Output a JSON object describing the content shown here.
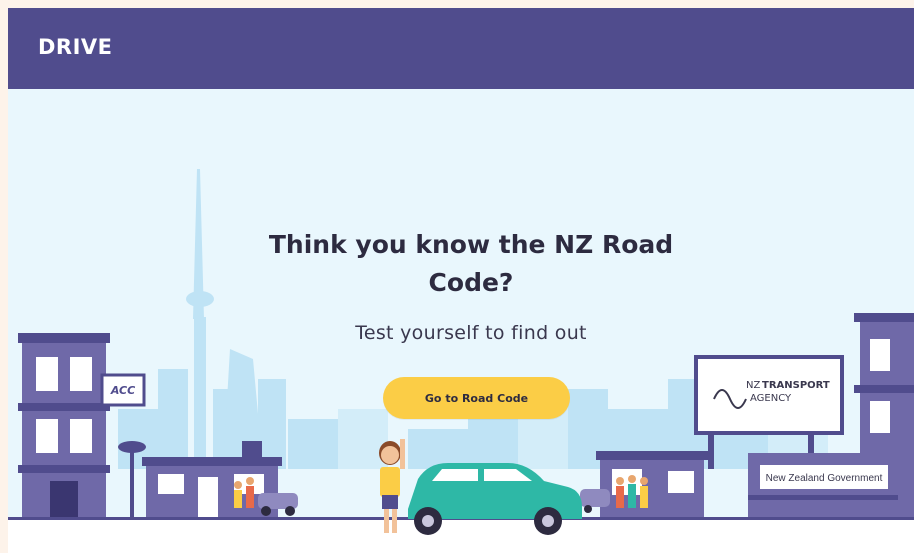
{
  "navbar": {
    "logo": "DRIVE"
  },
  "hero": {
    "headline_line1": "Think you know the NZ Road",
    "headline_line2": "Code?",
    "subhead": "Test yourself to find out",
    "cta_label": "Go to Road Code"
  },
  "signs": {
    "acc": "ACC",
    "nzta_prefix": "NZ",
    "nzta_line1": "TRANSPORT",
    "nzta_line2": "AGENCY",
    "gov": "New Zealand Government"
  },
  "colors": {
    "nav_bg": "#504c8d",
    "page_bg": "#e9f7fd",
    "cta_bg": "#fbcd46",
    "car": "#2eb8a6",
    "building": "#6f69a8"
  }
}
